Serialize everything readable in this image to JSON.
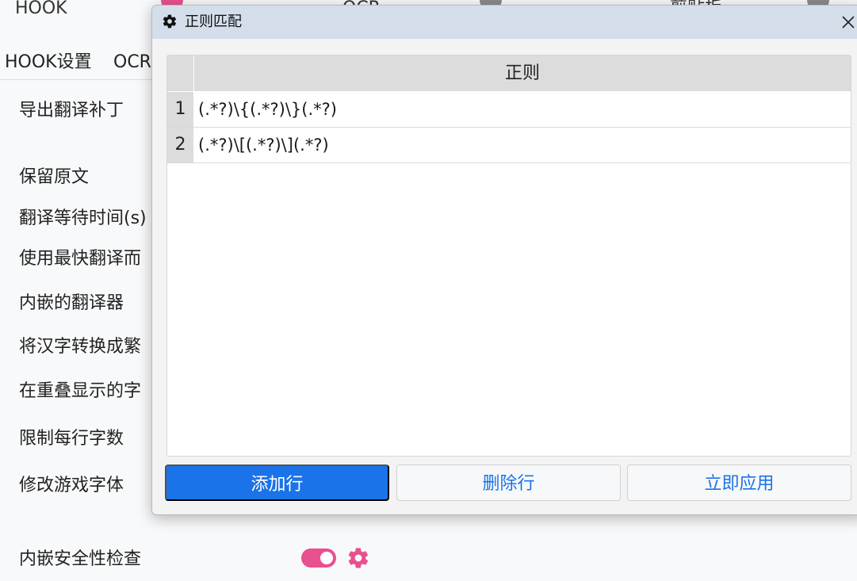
{
  "background": {
    "tabs": [
      {
        "label": "HOOK"
      },
      {
        "label": "OCR"
      },
      {
        "label": "剪贴板"
      }
    ],
    "subtabs": [
      {
        "label": "HOOK设置"
      },
      {
        "label": "OCR"
      }
    ],
    "settings": [
      {
        "label": "导出翻译补丁"
      },
      {
        "label": "保留原文"
      },
      {
        "label": "翻译等待时间(s)"
      },
      {
        "label": "使用最快翻译而"
      },
      {
        "label": "内嵌的翻译器"
      },
      {
        "label": "将汉字转换成繁"
      },
      {
        "label": "在重叠显示的字"
      },
      {
        "label": "限制每行字数"
      },
      {
        "label": "修改游戏字体"
      },
      {
        "label": "内嵌安全性检查"
      }
    ],
    "toggle_state": "on",
    "accent_color": "#e8508f"
  },
  "dialog": {
    "title": "正则匹配",
    "title_icon": "gear-icon",
    "close_icon": "close-icon",
    "table": {
      "columns": [
        "正则"
      ],
      "rows": [
        {
          "index": "1",
          "pattern": "(.*?)\\{(.*?)\\}(.*?)"
        },
        {
          "index": "2",
          "pattern": "(.*?)\\[(.*?)\\](.*?)"
        }
      ]
    },
    "buttons": {
      "add_row": "添加行",
      "delete_row": "删除行",
      "apply_now": "立即应用"
    },
    "primary_color": "#1a73e8"
  }
}
